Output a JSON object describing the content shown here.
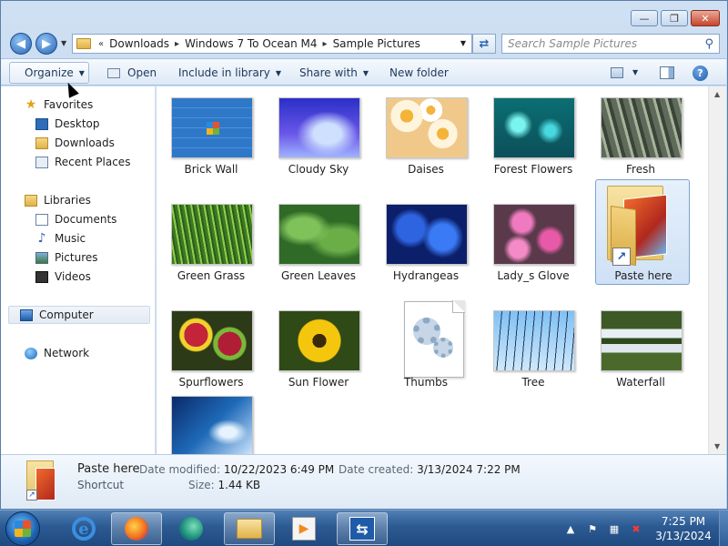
{
  "window": {
    "controls": {
      "minimize": "—",
      "maximize": "❐",
      "close": "✕"
    }
  },
  "address_bar": {
    "prefix": "«",
    "crumbs": [
      "Downloads",
      "Windows 7 To Ocean M4",
      "Sample Pictures"
    ],
    "separator": "▸"
  },
  "search": {
    "placeholder": "Search Sample Pictures"
  },
  "toolbar": {
    "organize": "Organize",
    "open": "Open",
    "include": "Include in library",
    "share": "Share with",
    "new_folder": "New folder",
    "help": "?"
  },
  "nav": {
    "favorites": "Favorites",
    "desktop": "Desktop",
    "downloads": "Downloads",
    "recent": "Recent Places",
    "libraries": "Libraries",
    "documents": "Documents",
    "music": "Music",
    "pictures": "Pictures",
    "videos": "Videos",
    "computer": "Computer",
    "network": "Network"
  },
  "files": [
    {
      "label": "Brick Wall",
      "thumb": "brick"
    },
    {
      "label": "Cloudy Sky",
      "thumb": "cloudy"
    },
    {
      "label": "Daises",
      "thumb": "daises"
    },
    {
      "label": "Forest Flowers",
      "thumb": "forest"
    },
    {
      "label": "Fresh",
      "thumb": "fresh"
    },
    {
      "label": "Green Grass",
      "thumb": "grass"
    },
    {
      "label": "Green Leaves",
      "thumb": "leaves"
    },
    {
      "label": "Hydrangeas",
      "thumb": "hydra"
    },
    {
      "label": "Lady_s Glove",
      "thumb": "lady"
    },
    {
      "label": "Paste here",
      "thumb": "shortcut-folder",
      "selected": true
    },
    {
      "label": "Spurflowers",
      "thumb": "spur"
    },
    {
      "label": "Sun Flower",
      "thumb": "sun"
    },
    {
      "label": "Thumbs",
      "thumb": "db-file"
    },
    {
      "label": "Tree",
      "thumb": "tree"
    },
    {
      "label": "Waterfall",
      "thumb": "water"
    },
    {
      "label": "",
      "thumb": "wave"
    }
  ],
  "details": {
    "name": "Paste here",
    "type": "Shortcut",
    "modified_key": "Date modified:",
    "modified_val": "10/22/2023 6:49 PM",
    "created_key": "Date created:",
    "created_val": "3/13/2024 7:22 PM",
    "size_key": "Size:",
    "size_val": "1.44 KB"
  },
  "taskbar": {
    "clock_time": "7:25 PM",
    "clock_date": "3/13/2024"
  }
}
